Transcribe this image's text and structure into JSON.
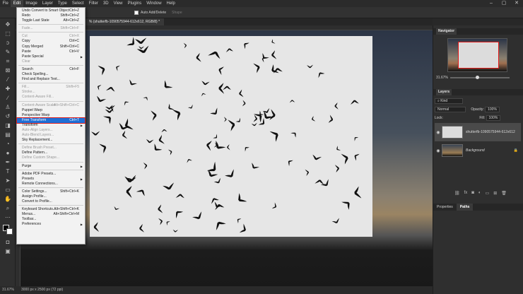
{
  "menubar": {
    "items": [
      "Fle",
      "Edit",
      "Image",
      "Layer",
      "Type",
      "Select",
      "Filter",
      "3D",
      "View",
      "Plugins",
      "Window",
      "Help"
    ],
    "active_index": 1,
    "window_controls": [
      "–",
      "▢",
      "✕"
    ]
  },
  "options": {
    "auto_add_delete": "Auto Add/Delete",
    "shape_label": "Shape"
  },
  "document": {
    "tab_title": "% (shutterfb-1090575944-612x612, RGB/8) *"
  },
  "status": {
    "zoom": "31.67%",
    "size": "3000 px x 2500 px (72 ppi)"
  },
  "edit_menu": {
    "groups": [
      [
        {
          "label": "Undo Convert to Smart Object",
          "shortcut": "Ctrl+Z"
        },
        {
          "label": "Redo",
          "shortcut": "Shift+Ctrl+Z"
        },
        {
          "label": "Toggle Last State",
          "shortcut": "Alt+Ctrl+Z"
        }
      ],
      [
        {
          "label": "Fade...",
          "shortcut": "Shift+Ctrl+F",
          "disabled": true
        }
      ],
      [
        {
          "label": "Cut",
          "shortcut": "Ctrl+X",
          "disabled": true
        },
        {
          "label": "Copy",
          "shortcut": "Ctrl+C"
        },
        {
          "label": "Copy Merged",
          "shortcut": "Shift+Ctrl+C"
        },
        {
          "label": "Paste",
          "shortcut": "Ctrl+V"
        },
        {
          "label": "Paste Special",
          "submenu": true
        },
        {
          "label": "Clear",
          "disabled": true
        }
      ],
      [
        {
          "label": "Search",
          "shortcut": "Ctrl+F"
        },
        {
          "label": "Check Spelling..."
        },
        {
          "label": "Find and Replace Text..."
        }
      ],
      [
        {
          "label": "Fill...",
          "shortcut": "Shift+F5",
          "disabled": true
        },
        {
          "label": "Stroke...",
          "disabled": true
        },
        {
          "label": "Content-Aware Fill...",
          "disabled": true
        }
      ],
      [
        {
          "label": "Content-Aware Scale",
          "shortcut": "Alt+Shift+Ctrl+C",
          "disabled": true
        },
        {
          "label": "Puppet Warp"
        },
        {
          "label": "Perspective Warp"
        },
        {
          "label": "Free Transform",
          "shortcut": "Ctrl+T",
          "selected": true
        },
        {
          "label": "Transform",
          "submenu": true
        },
        {
          "label": "Auto-Align Layers...",
          "disabled": true
        },
        {
          "label": "Auto-Blend Layers...",
          "disabled": true
        },
        {
          "label": "Sky Replacement..."
        }
      ],
      [
        {
          "label": "Define Brush Preset...",
          "disabled": true
        },
        {
          "label": "Define Pattern..."
        },
        {
          "label": "Define Custom Shape...",
          "disabled": true
        }
      ],
      [
        {
          "label": "Purge",
          "submenu": true
        }
      ],
      [
        {
          "label": "Adobe PDF Presets..."
        },
        {
          "label": "Presets",
          "submenu": true
        },
        {
          "label": "Remote Connections..."
        }
      ],
      [
        {
          "label": "Color Settings...",
          "shortcut": "Shift+Ctrl+K"
        },
        {
          "label": "Assign Profile..."
        },
        {
          "label": "Convert to Profile..."
        }
      ],
      [
        {
          "label": "Keyboard Shortcuts...",
          "shortcut": "Alt+Shift+Ctrl+K"
        },
        {
          "label": "Menus...",
          "shortcut": "Alt+Shift+Ctrl+M"
        },
        {
          "label": "Toolbar..."
        },
        {
          "label": "Preferences",
          "submenu": true
        }
      ]
    ]
  },
  "navigator": {
    "title": "Navigator",
    "zoom": "31.67%"
  },
  "layers": {
    "title": "Layers",
    "kind": "Kind",
    "blend": "Normal",
    "opacity_label": "Opacity:",
    "opacity": "100%",
    "lock_label": "Lock:",
    "fill_label": "Fill:",
    "fill": "100%",
    "items": [
      {
        "name": "shutterfb-1090575944-612x612",
        "type": "smart"
      },
      {
        "name": "Background",
        "type": "background"
      }
    ]
  },
  "bottom_tabs": [
    "Properties",
    "Paths"
  ],
  "bottom_tabs_active": 1,
  "colors": {
    "highlight": "#1f6fd6",
    "outline": "#e02020"
  }
}
